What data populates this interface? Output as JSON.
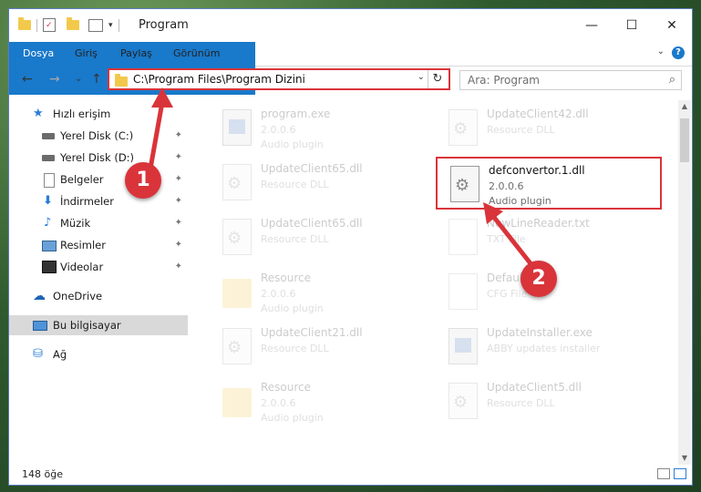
{
  "window": {
    "title": "Program",
    "min_glyph": "—",
    "max_glyph": "☐",
    "close_glyph": "✕"
  },
  "ribbon": {
    "tabs": [
      "Dosya",
      "Giriş",
      "Paylaş",
      "Görünüm"
    ],
    "help_glyph": "?",
    "collapse_glyph": "⌄"
  },
  "nav": {
    "back_glyph": "←",
    "forward_glyph": "→",
    "recent_glyph": "⌄",
    "up_glyph": "↑"
  },
  "address": {
    "path": "C:\\Program Files\\Program Dizini",
    "dropdown_glyph": "⌄",
    "refresh_glyph": "↻"
  },
  "search": {
    "placeholder": "Ara: Program",
    "icon_glyph": "⌕"
  },
  "sidebar": {
    "items": [
      {
        "label": "Hızlı erişim",
        "icon": "star-icon",
        "pinned": false
      },
      {
        "label": "Yerel Disk (C:)",
        "icon": "drive-icon",
        "pinned": true
      },
      {
        "label": "Yerel Disk (D:)",
        "icon": "drive-icon",
        "pinned": true
      },
      {
        "label": "Belgeler",
        "icon": "document-icon",
        "pinned": true
      },
      {
        "label": "İndirmeler",
        "icon": "download-icon",
        "pinned": true
      },
      {
        "label": "Müzik",
        "icon": "music-icon",
        "pinned": true
      },
      {
        "label": "Resimler",
        "icon": "pictures-icon",
        "pinned": true
      },
      {
        "label": "Videolar",
        "icon": "video-icon",
        "pinned": true
      },
      {
        "label": "OneDrive",
        "icon": "cloud-icon",
        "pinned": false
      },
      {
        "label": "Bu bilgisayar",
        "icon": "computer-icon",
        "pinned": false,
        "selected": true
      },
      {
        "label": "Ağ",
        "icon": "network-icon",
        "pinned": false
      }
    ],
    "pin_glyph": "📌"
  },
  "files": [
    {
      "name": "program.exe",
      "line2": "2.0.0.6",
      "line3": "Audio plugin",
      "type": "exe"
    },
    {
      "name": "UpdateClient42.dll",
      "line2": "Resource DLL",
      "line3": "",
      "type": "dll"
    },
    {
      "name": "UpdateClient65.dll",
      "line2": "Resource DLL",
      "line3": "",
      "type": "dll"
    },
    {
      "name": "defconvertor.1.dll",
      "line2": "2.0.0.6",
      "line3": "Audio plugin",
      "type": "dll",
      "highlighted": true
    },
    {
      "name": "UpdateClient65.dll",
      "line2": "Resource DLL",
      "line3": "",
      "type": "dll"
    },
    {
      "name": "NewLineReader.txt",
      "line2": "TXT File",
      "line3": "",
      "type": "txt"
    },
    {
      "name": "Resource",
      "line2": "2.0.0.6",
      "line3": "Audio plugin",
      "type": "folder"
    },
    {
      "name": "Default.cfg",
      "line2": "CFG File",
      "line3": "",
      "type": "cfg"
    },
    {
      "name": "UpdateClient21.dll",
      "line2": "Resource DLL",
      "line3": "",
      "type": "dll"
    },
    {
      "name": "UpdateInstaller.exe",
      "line2": "ABBY updates installer",
      "line3": "",
      "type": "exe"
    },
    {
      "name": "Resource",
      "line2": "2.0.0.6",
      "line3": "Audio plugin",
      "type": "folder"
    },
    {
      "name": "UpdateClient5.dll",
      "line2": "Resource DLL",
      "line3": "",
      "type": "dll"
    }
  ],
  "status": {
    "item_count": "148 öğe"
  },
  "annotations": {
    "step1": "1",
    "step2": "2",
    "color": "#d9343a"
  },
  "colors": {
    "accent": "#1979ca",
    "highlight": "#d9343a"
  }
}
